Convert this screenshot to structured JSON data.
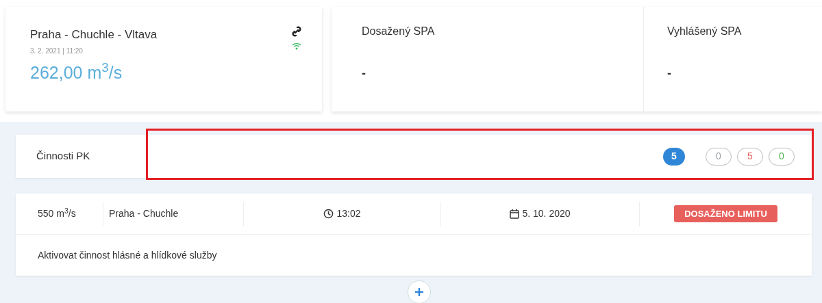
{
  "station": {
    "name": "Praha - Chuchle - Vltava",
    "timestamp": "3. 2. 2021 | 11:20",
    "flow": "262,00 m$^{3}$/s"
  },
  "spa": [
    {
      "label": "Dosažený SPA",
      "value": "-"
    },
    {
      "label": "Vyhlášený SPA",
      "value": "-"
    }
  ],
  "activities": {
    "title": "Činnosti PK",
    "highlighted": true,
    "total": "5",
    "counts": [
      {
        "value": "0",
        "color": "#9aa0a6"
      },
      {
        "value": "5",
        "color": "#e8605c"
      },
      {
        "value": "0",
        "color": "#4caf50"
      }
    ]
  },
  "limit": {
    "flow": "550 m$^{3}$/s",
    "place": "Praha - Chuchle",
    "time": "13:02",
    "date": "5. 10. 2020",
    "status": "DOSAŽENO LIMITU",
    "action": "Aktivovat činnost hlásné a hlídkové služby"
  }
}
